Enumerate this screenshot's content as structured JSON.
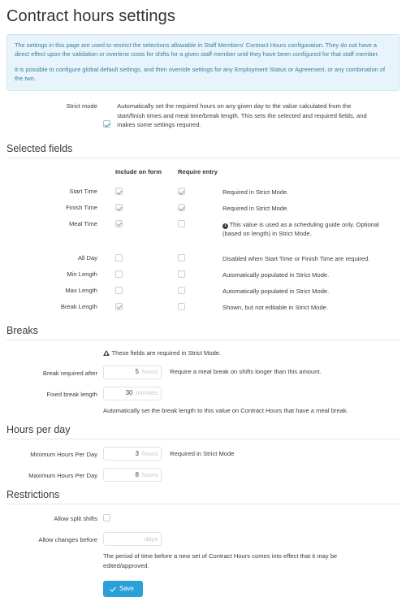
{
  "page": {
    "title": "Contract hours settings"
  },
  "info_alert": {
    "paragraph1": "The settings in this page are used to restrict the selections allowable in Staff Members' Contract Hours configuration. They do not have a direct effect upon the validation or overtime costs for shifts for a given staff member until they have been configured for that staff member.",
    "paragraph2": "It is possible to configure global default settings, and then override settings for any Employment Status or Agreement, or any combination of the two."
  },
  "strict_mode": {
    "label": "Strict mode",
    "checked": true,
    "help": "Automatically set the required hours on any given day to the value calculated from the start/finish times and meal time/break length. This sets the selected and required fields, and makes some settings required."
  },
  "selected_fields": {
    "heading": "Selected fields",
    "columns": {
      "include": "Include on form",
      "require": "Require entry"
    },
    "rows": [
      {
        "label": "Start Time",
        "include": true,
        "require": true,
        "note": "Required in Strict Mode.",
        "icon": ""
      },
      {
        "label": "Finish Time",
        "include": true,
        "require": true,
        "note": "Required in Strict Mode.",
        "icon": ""
      },
      {
        "label": "Meal Time",
        "include": true,
        "require": false,
        "note": "This value is used as a scheduling guide only. Optional (based on length) in Strict Mode.",
        "icon": "info-icon"
      },
      {
        "label": "All Day",
        "include": false,
        "require": false,
        "note": "Disabled when Start Time or Finish Time are required.",
        "icon": ""
      },
      {
        "label": "Min Length",
        "include": false,
        "require": false,
        "note": "Automatically populated in Strict Mode.",
        "icon": ""
      },
      {
        "label": "Max Length",
        "include": false,
        "require": false,
        "note": "Automatically populated in Strict Mode.",
        "icon": ""
      },
      {
        "label": "Break Length",
        "include": true,
        "require": false,
        "note": "Shown, but not editable in Strict Mode.",
        "icon": ""
      }
    ]
  },
  "breaks": {
    "heading": "Breaks",
    "warning": "These fields are required in Strict Mode.",
    "break_required_after": {
      "label": "Break required after",
      "value": "5",
      "unit": "hours",
      "help": "Require a meal break on shifts longer than this amount."
    },
    "fixed_break_length": {
      "label": "Fixed break length",
      "value": "30",
      "unit": "minutes",
      "help": "Automatically set the break length to this value on Contract Hours that have a meal break."
    }
  },
  "hours_per_day": {
    "heading": "Hours per day",
    "minimum": {
      "label": "Minimum Hours Per Day",
      "value": "3",
      "unit": "hours",
      "help": "Required in Strict Mode"
    },
    "maximum": {
      "label": "Maximum Hours Per Day",
      "value": "8",
      "unit": "hours",
      "help": ""
    }
  },
  "restrictions": {
    "heading": "Restrictions",
    "allow_split_shifts": {
      "label": "Allow split shifts",
      "checked": false
    },
    "allow_changes_before": {
      "label": "Allow changes before",
      "value": "",
      "placeholder": "days",
      "help": "The period of time before a new set of Contract Hours comes into effect that it may be edited/approved."
    }
  },
  "footer": {
    "save_label": "Save"
  },
  "colors": {
    "accent": "#2a9fd8",
    "alert_bg": "#e8f4fb",
    "alert_border": "#cde5f2",
    "alert_text": "#3c7d9e"
  }
}
